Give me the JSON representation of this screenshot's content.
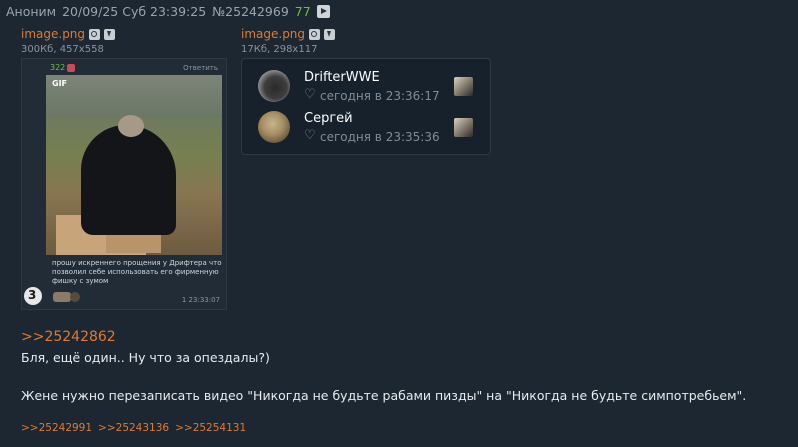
{
  "post": {
    "author": "Аноним",
    "datetime": "20/09/25 Суб 23:39:25",
    "number": "№25242969",
    "replies_count": "77"
  },
  "files": [
    {
      "name": "image.png",
      "meta": "300Кб, 457x558"
    },
    {
      "name": "image.png",
      "meta": "17Кб, 298x117"
    }
  ],
  "thumb1": {
    "counter": "322",
    "reply_label": "Ответить",
    "gif_label": "GIF",
    "caption": "прошу искреннего прощения у Дрифтера что позволил себе использовать его фирменную фишку с зумом",
    "time": "1  23:33:07"
  },
  "thumb2": {
    "users": [
      {
        "name": "DrifterWWE",
        "time": "сегодня в 23:36:17"
      },
      {
        "name": "Сергей",
        "time": "сегодня в 23:35:36"
      }
    ]
  },
  "body": {
    "reply_ref": ">>25242862",
    "line1": "Бля, ещё один.. Ну что за опездалы?)",
    "line2": "Жене нужно перезаписать видео \"Никогда не будьте рабами пизды\" на \"Никогда не будьте симпотребьем\"."
  },
  "backlinks": [
    ">>25242991",
    ">>25243136",
    ">>25254131"
  ]
}
